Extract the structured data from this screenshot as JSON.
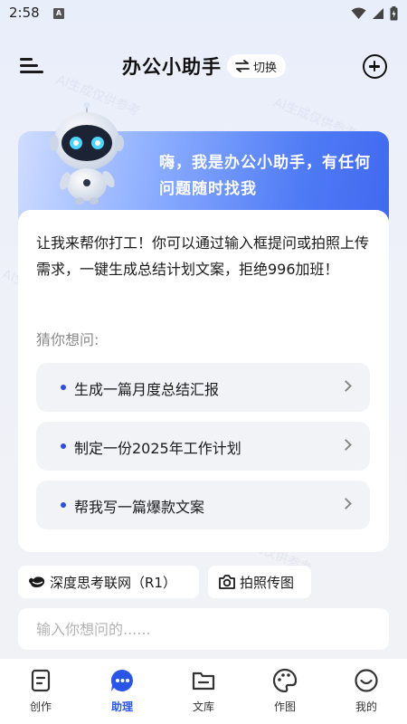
{
  "status_bar": {
    "time": "2:58",
    "notification_badge": "A"
  },
  "header": {
    "title": "办公小助手",
    "switch_label": "切换"
  },
  "hero": {
    "greeting": "嗨，我是办公小助手，有任何问题随时找我"
  },
  "card": {
    "intro": "让我来帮你打工！你可以通过输入框提问或拍照上传需求，一键生成总结计划文案，拒绝996加班！",
    "guess_label": "猜你想问:",
    "suggestions": [
      {
        "label": "生成一篇月度总结汇报"
      },
      {
        "label": "制定一份2025年工作计划"
      },
      {
        "label": "帮我写一篇爆款文案"
      }
    ]
  },
  "chips": {
    "deep_think": "深度思考联网（R1）",
    "photo": "拍照传图"
  },
  "input": {
    "placeholder": "输入你想问的......"
  },
  "bottom_nav": [
    {
      "label": "创作",
      "icon": "document-icon"
    },
    {
      "label": "助理",
      "icon": "chat-bubble-icon",
      "active": true
    },
    {
      "label": "文库",
      "icon": "folder-icon"
    },
    {
      "label": "作图",
      "icon": "palette-icon"
    },
    {
      "label": "我的",
      "icon": "smiley-icon"
    }
  ],
  "watermark": "AI生成仅供参考",
  "colors": {
    "accent": "#2b55e8",
    "hero_start": "#cfdcff",
    "hero_end": "#4168f0"
  }
}
